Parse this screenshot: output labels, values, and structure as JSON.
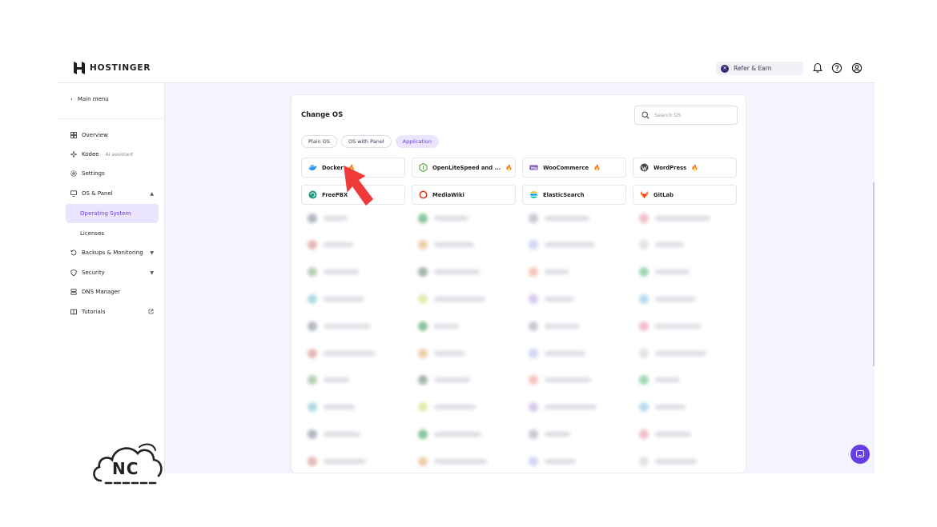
{
  "brand": {
    "name": "HOSTINGER"
  },
  "topbar": {
    "refer_label": "Refer & Earn",
    "icons": [
      "bell-icon",
      "help-icon",
      "account-icon"
    ]
  },
  "sidebar": {
    "back_label": "Main menu",
    "items": [
      {
        "label": "Overview",
        "icon": "grid-icon"
      },
      {
        "label": "Kodee",
        "tag": "AI assistant",
        "icon": "sparkle-icon"
      },
      {
        "label": "Settings",
        "icon": "gear-icon"
      },
      {
        "label": "OS & Panel",
        "icon": "monitor-icon"
      },
      {
        "label": "Operating System",
        "active": true
      },
      {
        "label": "Licenses"
      },
      {
        "label": "Backups & Monitoring",
        "icon": "backup-icon"
      },
      {
        "label": "Security",
        "icon": "shield-icon"
      },
      {
        "label": "DNS Manager",
        "icon": "dns-icon"
      },
      {
        "label": "Tutorials",
        "icon": "book-icon"
      }
    ]
  },
  "panel": {
    "title": "Change OS",
    "search_placeholder": "Search OS",
    "tabs": [
      {
        "label": "Plain OS"
      },
      {
        "label": "OS with Panel"
      },
      {
        "label": "Application",
        "active": true
      }
    ],
    "apps": [
      {
        "label": "Docker",
        "popular": true,
        "icon": "docker-icon",
        "color": "#2496ed"
      },
      {
        "label": "OpenLiteSpeed and ...",
        "popular": true,
        "icon": "nodejs-icon",
        "color": "#5fa04e"
      },
      {
        "label": "WooCommerce",
        "popular": true,
        "icon": "woocommerce-icon",
        "color": "#7f54b3"
      },
      {
        "label": "WordPress",
        "popular": true,
        "icon": "wordpress-icon",
        "color": "#464646"
      },
      {
        "label": "FreePBX",
        "popular": false,
        "icon": "freepbx-icon",
        "color": "#1d9a80"
      },
      {
        "label": "MediaWiki",
        "popular": false,
        "icon": "mediawiki-icon",
        "color": "#e0381d"
      },
      {
        "label": "ElasticSearch",
        "popular": false,
        "icon": "elasticsearch-icon",
        "color": "#00bfb3"
      },
      {
        "label": "GitLab",
        "popular": false,
        "icon": "gitlab-icon",
        "color": "#fc6d26"
      }
    ],
    "popular_glyph": "🔥"
  },
  "watermark": {
    "text": "NC"
  },
  "colors": {
    "accent": "#673de6",
    "accent_soft": "#ebe4ff",
    "arrow": "#f03a3a"
  }
}
